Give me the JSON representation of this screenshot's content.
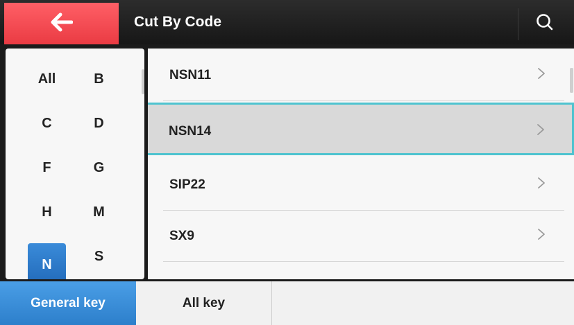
{
  "header": {
    "title": "Cut By Code",
    "back_icon": "arrow-left-icon",
    "search_icon": "search-icon",
    "colors": {
      "back_button": "#ea3b43",
      "bar": "#1f1f1f"
    }
  },
  "letters": {
    "items": [
      "All",
      "B",
      "C",
      "D",
      "F",
      "G",
      "H",
      "M",
      "N",
      "S"
    ],
    "selected": "N"
  },
  "codes": {
    "items": [
      {
        "label": "NSN11",
        "selected": false
      },
      {
        "label": "NSN14",
        "selected": true
      },
      {
        "label": "SIP22",
        "selected": false
      },
      {
        "label": "SX9",
        "selected": false
      }
    ],
    "chevron_icon": "chevron-right-icon",
    "selection_color": "#4ec3cf"
  },
  "tabs": {
    "general": "General key",
    "all": "All key",
    "active": "General key",
    "active_color": "#2d7fcb"
  }
}
